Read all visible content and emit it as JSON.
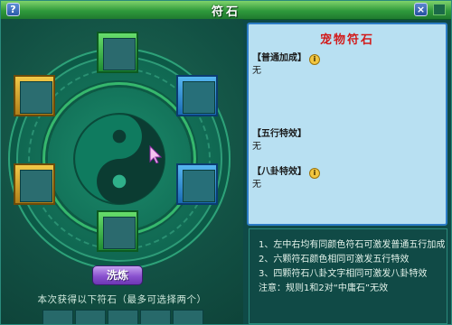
{
  "window": {
    "title": "符石"
  },
  "titlebar": {
    "help_label": "?",
    "close_label": "×"
  },
  "board": {
    "wash_button_label": "洗炼",
    "hint_text": "本次获得以下符石（最多可选择两个）"
  },
  "panel": {
    "title": "宠物符石",
    "sections": [
      {
        "label": "【普通加成】",
        "value": "无"
      },
      {
        "label": "【五行特效】",
        "value": "无"
      },
      {
        "label": "【八卦特效】",
        "value": "无"
      }
    ]
  },
  "rules": [
    "1、左中右均有同颜色符石可激发普通五行加成",
    "2、六颗符石颜色相同可激发五行特效",
    "3、四颗符石八卦文字相同可激发八卦特效",
    "注意：规则1和2对“中庸石”无效"
  ],
  "colors": {
    "title_bar": "#2f9a3c",
    "panel_bg": "#b8e0f2",
    "panel_title": "#d21a1a",
    "wash_button": "#8a52cf"
  },
  "icons": [
    "help-icon",
    "close-icon",
    "info-icon",
    "yin-yang-icon",
    "cursor-icon"
  ]
}
